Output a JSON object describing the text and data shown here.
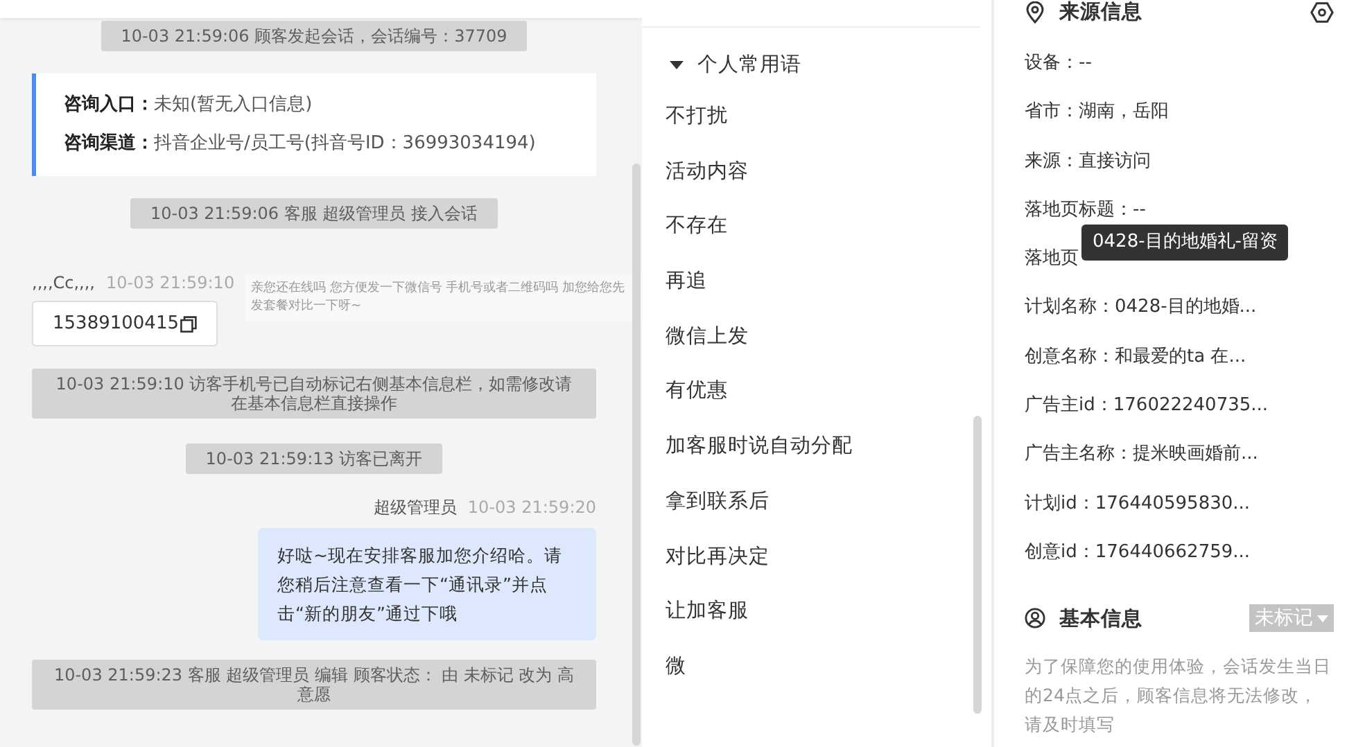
{
  "chat": {
    "events": [
      {
        "kind": "system",
        "text": "10-03 21:59:06 顾客发起会话，会话编号：37709"
      },
      {
        "kind": "entry_info",
        "rows": [
          {
            "label": "咨询入口：",
            "value": "未知(暂无入口信息)"
          },
          {
            "label": "咨询渠道：",
            "value": "抖音企业号/员工号(抖音号ID：36993034194)"
          }
        ]
      },
      {
        "kind": "system",
        "text": "10-03 21:59:06 客服 超级管理员 接入会话"
      },
      {
        "kind": "visitor",
        "name": ",,,,Cc,,,,",
        "time": "10-03 21:59:10",
        "text": "15389100415"
      },
      {
        "kind": "system",
        "text": "10-03 21:59:10 访客手机号已自动标记右侧基本信息栏，如需修改请在基本信息栏直接操作"
      },
      {
        "kind": "system",
        "text": "10-03 21:59:13 访客已离开"
      },
      {
        "kind": "agent",
        "name": "超级管理员",
        "time": "10-03 21:59:20",
        "text": "好哒~现在安排客服加您介绍哈。请您稍后注意查看一下“通讯录”并点击“新的朋友”通过下哦"
      },
      {
        "kind": "system",
        "text": "10-03 21:59:23 客服 超级管理员 编辑 顾客状态： 由 未标记 改为 高意愿"
      }
    ],
    "hover_preview": "亲您还在线吗 您方便发一下微信号 手机号或者二维码吗 加您给您先发套餐对比一下呀~"
  },
  "quick_replies": {
    "group": "个人常用语",
    "expanded": true,
    "items": [
      "不打扰",
      "活动内容",
      "不存在",
      "再追",
      "微信上发",
      "有优惠",
      "加客服时说自动分配",
      "拿到联系后",
      "对比再决定",
      "让加客服",
      "微"
    ]
  },
  "source_info": {
    "title": "来源信息",
    "fields": [
      {
        "label": "设备：",
        "value": "--"
      },
      {
        "label": "省市：",
        "value": "湖南，岳阳"
      },
      {
        "label": "来源：",
        "value": "直接访问"
      },
      {
        "label": "落地页标题：",
        "value": "--"
      },
      {
        "label": "落地页"
      },
      {
        "label": "计划名称：",
        "value": "0428-目的地婚..."
      },
      {
        "label": "创意名称：",
        "value": "和最爱的ta 在..."
      },
      {
        "label": "广告主id：",
        "value": "176022240735..."
      },
      {
        "label": "广告主名称：",
        "value": "提米映画婚前..."
      },
      {
        "label": "计划id：",
        "value": "176440595830..."
      },
      {
        "label": "创意id：",
        "value": "176440662759..."
      }
    ],
    "tooltip": "0428-目的地婚礼-留资"
  },
  "basic_info": {
    "title": "基本信息",
    "status": "未标记",
    "note": "为了保障您的使用体验，会话发生当日的24点之后，顾客信息将无法修改，请及时填写"
  }
}
